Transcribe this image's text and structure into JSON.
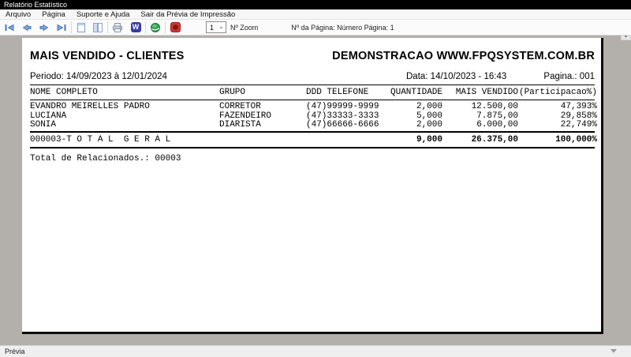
{
  "window": {
    "title": "Relatório Estatístico"
  },
  "menu": {
    "items": [
      "Arquivo",
      "Página",
      "Suporte e Ajuda",
      "Sair da Prévia de Impressão"
    ]
  },
  "toolbar": {
    "icons": [
      "first-page",
      "previous-page",
      "next-page",
      "last-page",
      "single-page-view",
      "two-page-view",
      "print",
      "export-word",
      "export-html",
      "close-report"
    ],
    "word_icon_text": "W",
    "zoom_value": "1",
    "zoom_label": "Nº Zoom",
    "page_label": "Nº da Página: Número Página: 1"
  },
  "report": {
    "title": "MAIS VENDIDO - CLIENTES",
    "company": "DEMONSTRACAO WWW.FPQSYSTEM.COM.BR",
    "period": "Periodo: 14/09/2023 à 12/01/2024",
    "date": "Data: 14/10/2023 - 16:43",
    "page_label": "Pagina.: 001",
    "table": {
      "headers": [
        "NOME COMPLETO",
        "GRUPO",
        "DDD TELEFONE",
        "QUANTIDADE",
        "MAIS VENDIDO",
        "(Participacao%)"
      ],
      "rows": [
        {
          "nome": "EVANDRO MEIRELLES PADRO",
          "grupo": "CORRETOR",
          "telefone": "(47)99999-9999",
          "quantidade": "2,000",
          "vendido": "12.500,00",
          "participacao": "47,393%"
        },
        {
          "nome": "LUCIANA",
          "grupo": "FAZENDEIRO",
          "telefone": "(47)33333-3333",
          "quantidade": "5,000",
          "vendido": "7.875,00",
          "participacao": "29,858%"
        },
        {
          "nome": "SONIA",
          "grupo": "DIARISTA",
          "telefone": "(47)66666-6666",
          "quantidade": "2,000",
          "vendido": "6.000,00",
          "participacao": "22,749%"
        }
      ],
      "total": {
        "label": "000003-T O T A L  G E R A L",
        "quantidade": "9,000",
        "vendido": "26.375,00",
        "participacao": "100,000%"
      }
    },
    "footer": "Total de Relacionados.: 00003"
  },
  "statusbar": {
    "label": "Prévia"
  },
  "colors": {
    "titlebar": "#000000",
    "preview_background": "#b3b0ac",
    "nav_arrow_blue": "#7fa7d9",
    "nav_arrow_border": "#4a79b8",
    "word_icon_blue": "#3a3aa8",
    "globe_green": "#2f9e4f",
    "close_red": "#cf3a34",
    "page_shadow": "#0a0a0a"
  }
}
